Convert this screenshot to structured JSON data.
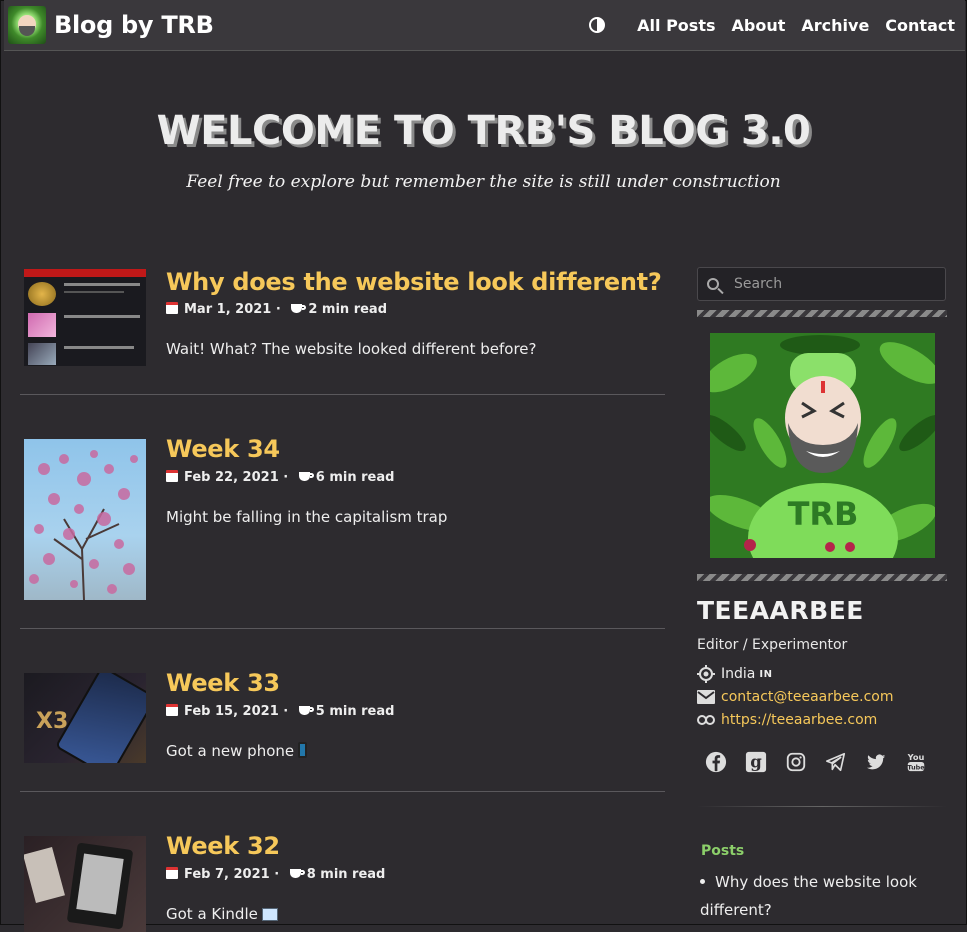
{
  "navbar": {
    "brand": "Blog by TRB",
    "links": [
      "All Posts",
      "About",
      "Archive",
      "Contact"
    ]
  },
  "hero": {
    "title": "WELCOME TO TRB'S BLOG 3.0",
    "subtitle": "Feel free to explore but remember the site is still under construction"
  },
  "posts": [
    {
      "title": "Why does the website look different?",
      "date": "Mar 1, 2021",
      "read_time": "2 min read",
      "excerpt": "Wait! What? The website looked different before?"
    },
    {
      "title": "Week 34",
      "date": "Feb 22, 2021",
      "read_time": "6 min read",
      "excerpt": "Might be falling in the capitalism trap"
    },
    {
      "title": "Week 33",
      "date": "Feb 15, 2021",
      "read_time": "5 min read",
      "excerpt": "Got a new phone"
    },
    {
      "title": "Week 32",
      "date": "Feb 7, 2021",
      "read_time": "8 min read",
      "excerpt": "Got a Kindle"
    }
  ],
  "sidebar": {
    "search_placeholder": "Search",
    "profile": {
      "name": "TEEAARBEE",
      "role": "Editor / Experimentor",
      "location": "India",
      "flag": "IN",
      "email": "contact@teeaarbee.com",
      "website": "https://teeaarbee.com"
    },
    "socials": [
      "facebook-icon",
      "goodreads-icon",
      "instagram-icon",
      "telegram-icon",
      "twitter-icon",
      "youtube-icon"
    ],
    "posts_heading": "Posts",
    "recent_posts": [
      "Why does the website look different?"
    ]
  },
  "colors": {
    "background": "#2d2b2f",
    "navbar": "#3a383c",
    "accent": "#f6c85a",
    "posts_heading": "#8ccf6a"
  }
}
